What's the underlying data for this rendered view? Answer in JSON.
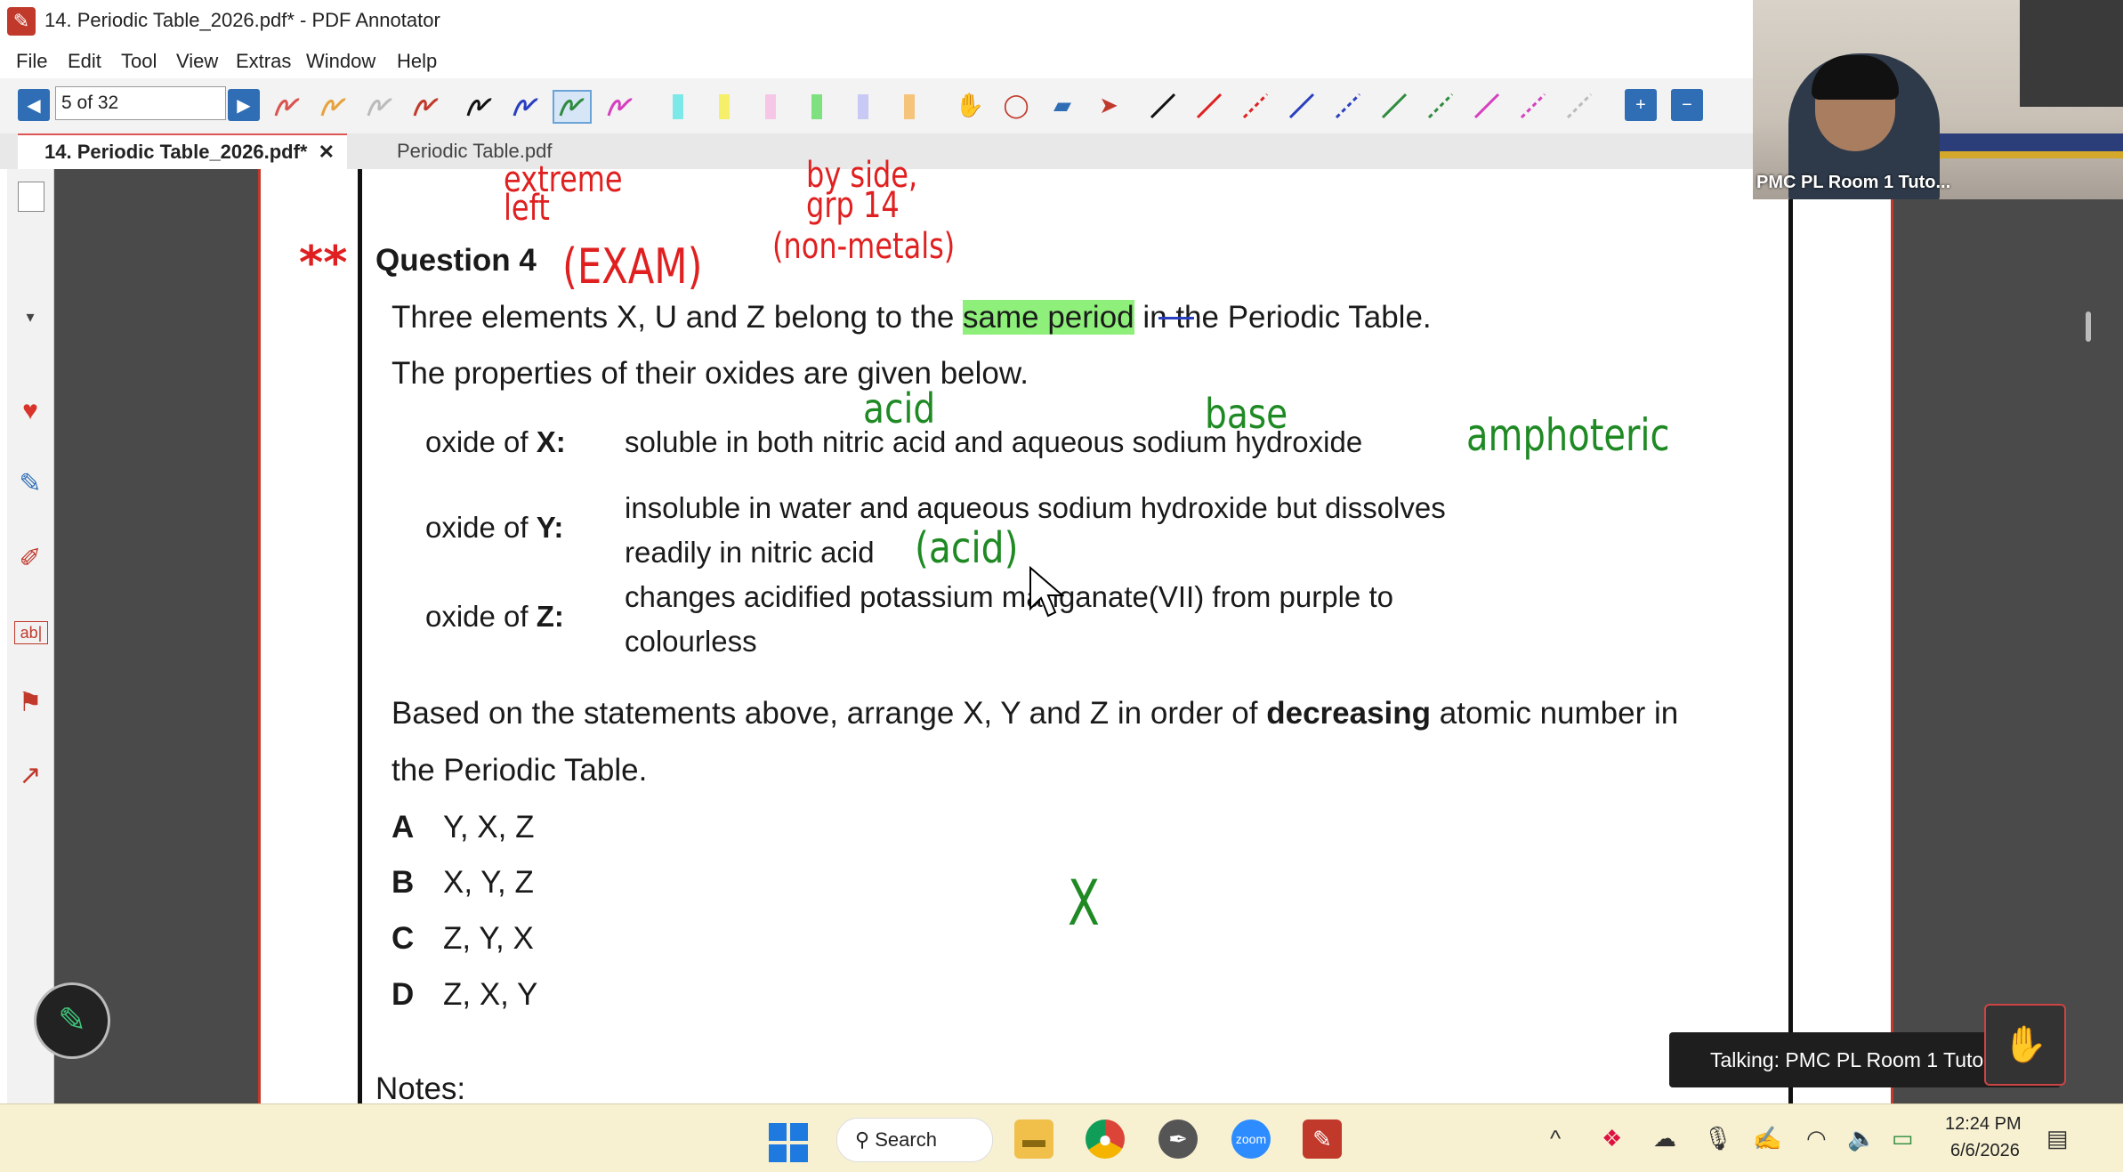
{
  "window": {
    "title": "14. Periodic Table_2026.pdf* - PDF Annotator"
  },
  "menu": [
    "File",
    "Edit",
    "Tool",
    "View",
    "Extras",
    "Window",
    "Help"
  ],
  "toolbar": {
    "page_indicator": "5 of 32"
  },
  "tabs": [
    {
      "label": "14. Periodic Table_2026.pdf*",
      "active": true,
      "close": "✕"
    },
    {
      "label": "Periodic Table.pdf",
      "active": false
    }
  ],
  "video": {
    "participant_label": "PMC PL Room 1 Tuto..."
  },
  "document": {
    "question_title": "Question 4",
    "intro_line1_a": "Three elements X, U and Z belong to the ",
    "intro_line1_hl": "same period",
    "intro_line1_b": " in the Periodic Table.",
    "intro_line2": "The properties of their oxides are given below.",
    "oxides": [
      {
        "label_pre": "oxide of ",
        "label_bold": "X",
        "label_post": ":",
        "line1": "soluble in both nitric acid and aqueous sodium hydroxide",
        "line2": ""
      },
      {
        "label_pre": "oxide of ",
        "label_bold": "Y",
        "label_post": ":",
        "line1": "insoluble in water and aqueous sodium hydroxide but dissolves",
        "line2": "readily in nitric acid"
      },
      {
        "label_pre": "oxide of ",
        "label_bold": "Z",
        "label_post": ":",
        "line1": "changes acidified potassium manganate(VII) from purple to",
        "line2": "colourless"
      }
    ],
    "prompt_a": "Based on the statements above, arrange X, Y and Z in order of ",
    "prompt_bold": "decreasing",
    "prompt_b": " atomic number in",
    "prompt_line2": "the Periodic Table.",
    "options": [
      {
        "letter": "A",
        "text": "Y, X, Z"
      },
      {
        "letter": "B",
        "text": "X, Y, Z"
      },
      {
        "letter": "C",
        "text": "Z, Y, X"
      },
      {
        "letter": "D",
        "text": "Z, X, Y"
      }
    ],
    "notes_label": "Notes:"
  },
  "annotations": {
    "red": {
      "extreme_left": [
        "extreme",
        "left"
      ],
      "side_grp": [
        "by side,",
        "grp 14"
      ],
      "non_metals": "(non-metals)",
      "exam": "(EXAM)",
      "stars": "**"
    },
    "green": {
      "acid_top": "acid",
      "base_top": "base",
      "amphoteric": "amphoteric",
      "acid_paren": "(acid)",
      "cross_x": "X"
    }
  },
  "toast": {
    "talking": "Talking: PMC PL Room 1 Tutor"
  },
  "taskbar": {
    "search_label": "Search",
    "time": "12:24 PM",
    "date": "6/6/2026"
  },
  "colors": {
    "accent_red": "#c0392b",
    "ink_red": "#e02020",
    "ink_green": "#1f8a24",
    "highlight_green": "#8ef07a",
    "nav_blue": "#2f6db5"
  }
}
